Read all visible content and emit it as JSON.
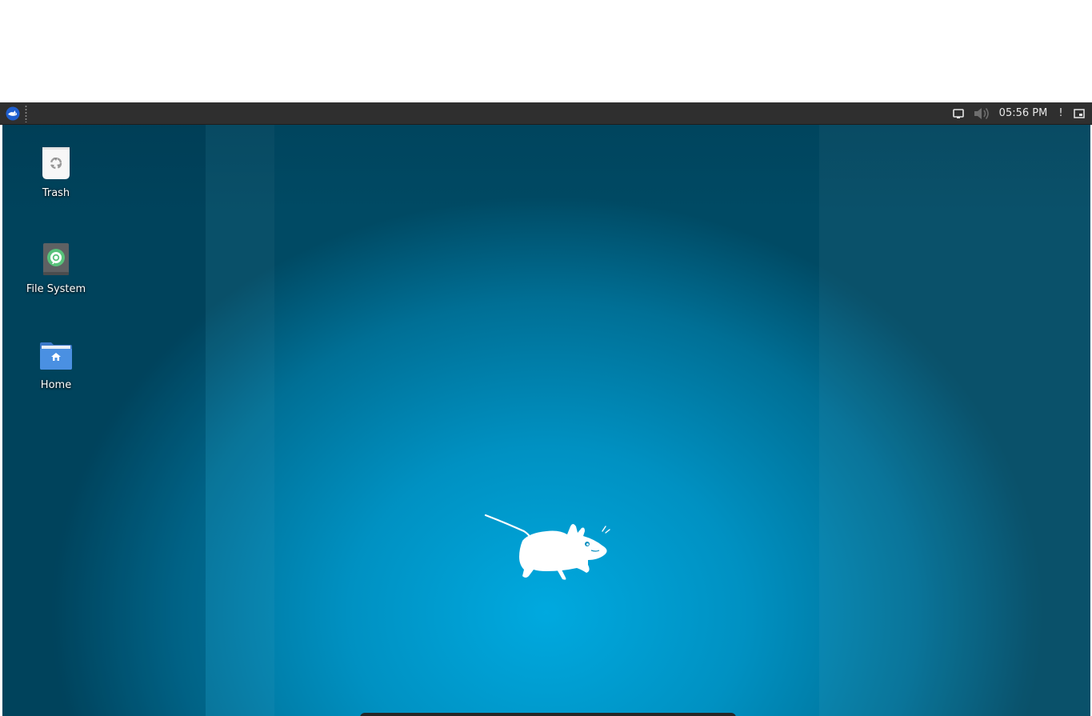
{
  "panel": {
    "clock": "05:56 PM",
    "notification_glyph": "!",
    "icons": [
      "xfce-menu-icon",
      "display-icon",
      "volume-muted-icon",
      "show-desktop-icon"
    ]
  },
  "desktop": {
    "icons": [
      {
        "label": "Trash",
        "icon": "trash-icon"
      },
      {
        "label": "File System",
        "icon": "drive-icon"
      },
      {
        "label": "Home",
        "icon": "home-folder-icon"
      }
    ]
  },
  "colors": {
    "panel_bg": "#2f2f2f",
    "desktop_center": "#00a9df",
    "desktop_edge": "#004a64",
    "text": "#ffffff"
  }
}
